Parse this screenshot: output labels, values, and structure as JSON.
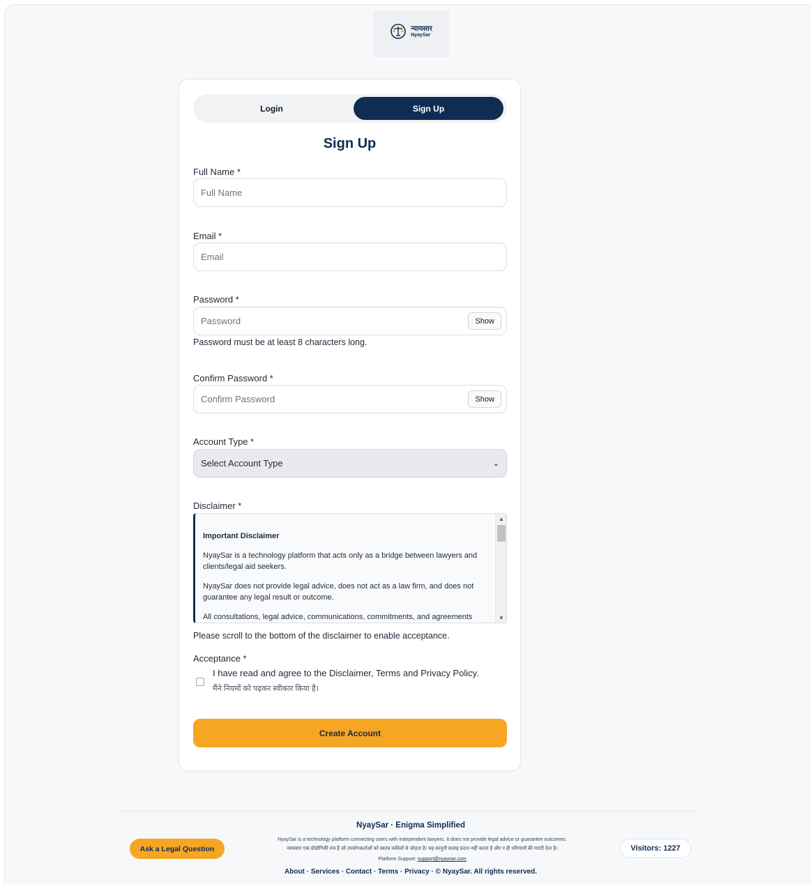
{
  "logo": {
    "hindi": "न्यायसार",
    "english": "NyaySar"
  },
  "tabs": {
    "login": "Login",
    "signup": "Sign Up"
  },
  "form": {
    "title": "Sign Up",
    "full_name": {
      "label": "Full Name *",
      "placeholder": "Full Name"
    },
    "email": {
      "label": "Email *",
      "placeholder": "Email"
    },
    "password": {
      "label": "Password *",
      "placeholder": "Password",
      "show": "Show",
      "hint": "Password must be at least 8 characters long."
    },
    "confirm_password": {
      "label": "Confirm Password *",
      "placeholder": "Confirm Password",
      "show": "Show"
    },
    "account_type": {
      "label": "Account Type *",
      "selected": "Select Account Type"
    },
    "disclaimer": {
      "label": "Disclaimer *",
      "heading": "Important Disclaimer",
      "p1": "NyaySar is a technology platform that acts only as a bridge between lawyers and clients/legal aid seekers.",
      "p2": "NyaySar does not provide legal advice, does not act as a law firm, and does not guarantee any legal result or outcome.",
      "p3": "All consultations, legal advice, communications, commitments, and agreements",
      "scroll_hint": "Please scroll to the bottom of the disclaimer to enable acceptance."
    },
    "acceptance": {
      "label": "Acceptance *",
      "text_en": "I have read and agree to the Disclaimer, Terms and Privacy Policy.",
      "text_hi": "मैंने नियमों को पढ़कर स्वीकार किया है।"
    },
    "submit": "Create Account"
  },
  "footer": {
    "title": "NyaySar · Enigma Simplified",
    "note_en": "NyaySar is a technology platform connecting users with independent lawyers. It does not provide legal advice or guarantee outcomes.",
    "note_hi": "न्यायसार एक प्रौद्योगिकी मंच है जो उपयोगकर्ताओं को स्वतंत्र वकीलों से जोड़ता है। यह कानूनी सलाह प्रदान नहीं करता है और न ही परिणामों की गारंटी देता है।",
    "support_label": "Platform Support:",
    "support_email": "support@nyaysar.com",
    "ask_button": "Ask a Legal Question",
    "visitors": "Visitors: 1227",
    "links": [
      "About",
      "Services",
      "Contact",
      "Terms",
      "Privacy"
    ],
    "copyright": "© NyaySar. All rights reserved."
  },
  "colors": {
    "navy": "#0f2d52",
    "accent": "#f6a623"
  }
}
